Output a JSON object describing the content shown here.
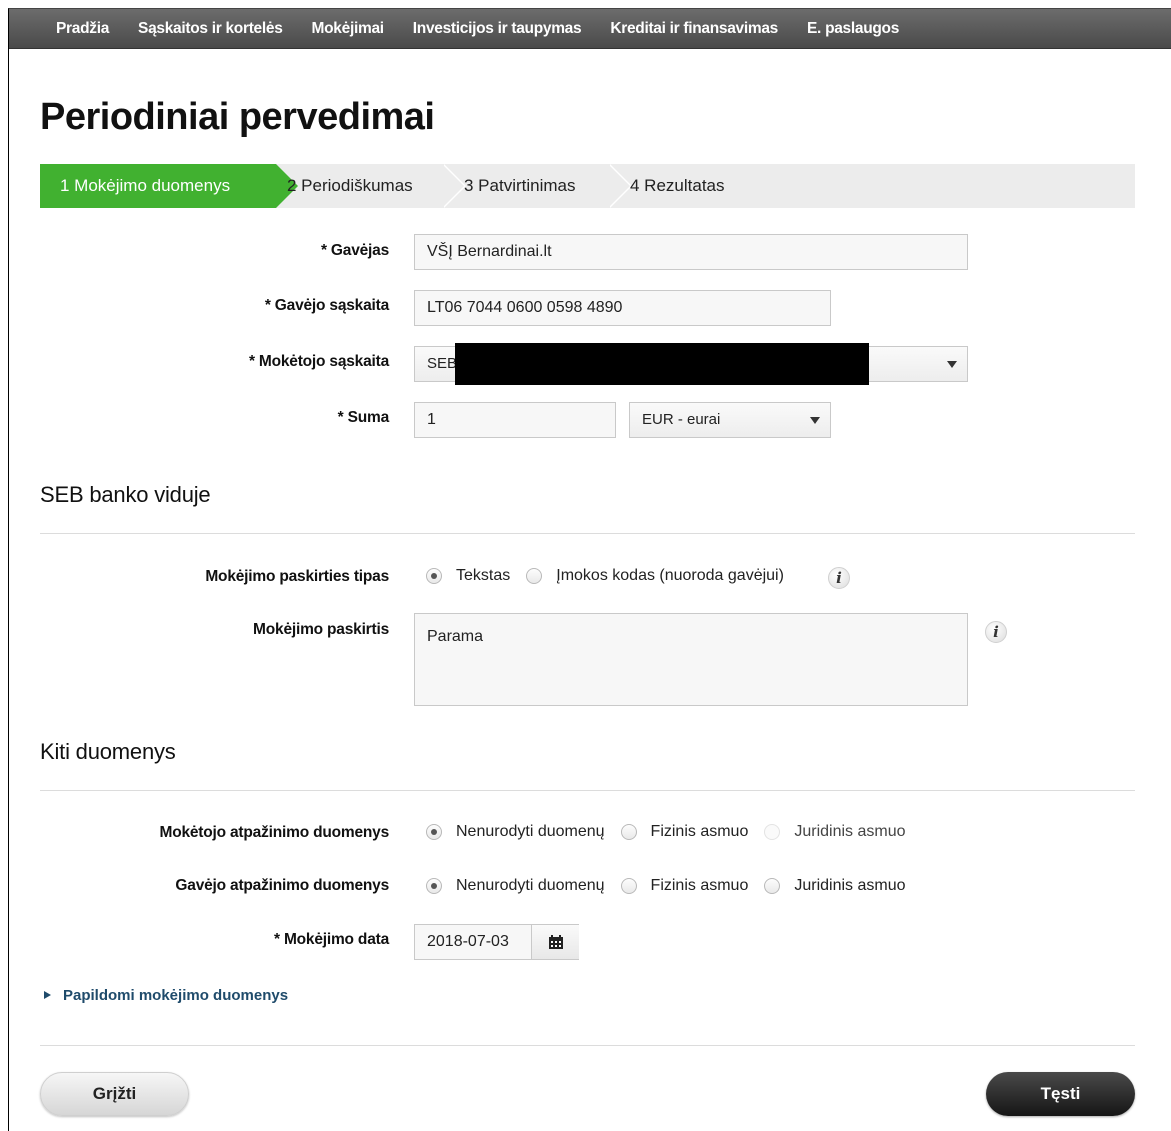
{
  "nav": {
    "items": [
      "Pradžia",
      "Sąskaitos ir kortelės",
      "Mokėjimai",
      "Investicijos ir taupymas",
      "Kreditai ir finansavimas",
      "E. paslaugos"
    ]
  },
  "page_title": "Periodiniai pervedimai",
  "steps": [
    {
      "label": "1  Mokėjimo duomenys",
      "active": true
    },
    {
      "label": "2  Periodiškumas",
      "active": false
    },
    {
      "label": "3  Patvirtinimas",
      "active": false
    },
    {
      "label": "4  Rezultatas",
      "active": false
    }
  ],
  "form": {
    "recipient_label": "* Gavėjas",
    "recipient_value": "VŠĮ Bernardinai.lt",
    "recipient_account_label": "* Gavėjo sąskaita",
    "recipient_account_value": "LT06 7044 0600 0598 4890",
    "payer_account_label": "* Mokėtojo sąskaita",
    "payer_account_value": "SEB",
    "amount_label": "* Suma",
    "amount_value": "1",
    "currency_value": "EUR - eurai"
  },
  "section_internal": {
    "title": "SEB banko viduje",
    "purpose_type_label": "Mokėjimo paskirties tipas",
    "purpose_type_options": [
      "Tekstas",
      "Įmokos kodas (nuoroda gavėjui)"
    ],
    "purpose_label": "Mokėjimo paskirtis",
    "purpose_value": "Parama"
  },
  "section_other": {
    "title": "Kiti duomenys",
    "payer_id_label": "Mokėtojo atpažinimo duomenys",
    "payer_id_options": [
      "Nenurodyti duomenų",
      "Fizinis asmuo",
      "Juridinis asmuo"
    ],
    "recipient_id_label": "Gavėjo atpažinimo duomenys",
    "recipient_id_options": [
      "Nenurodyti duomenų",
      "Fizinis asmuo",
      "Juridinis asmuo"
    ],
    "date_label": "* Mokėjimo data",
    "date_value": "2018-07-03"
  },
  "expander_label": "Papildomi mokėjimo duomenys",
  "buttons": {
    "back": "Grįžti",
    "next": "Tęsti"
  },
  "icons": {
    "info": "i"
  },
  "colors": {
    "active_step": "#41b130",
    "nav_bg": "#555555",
    "link": "#1f4b6b"
  }
}
